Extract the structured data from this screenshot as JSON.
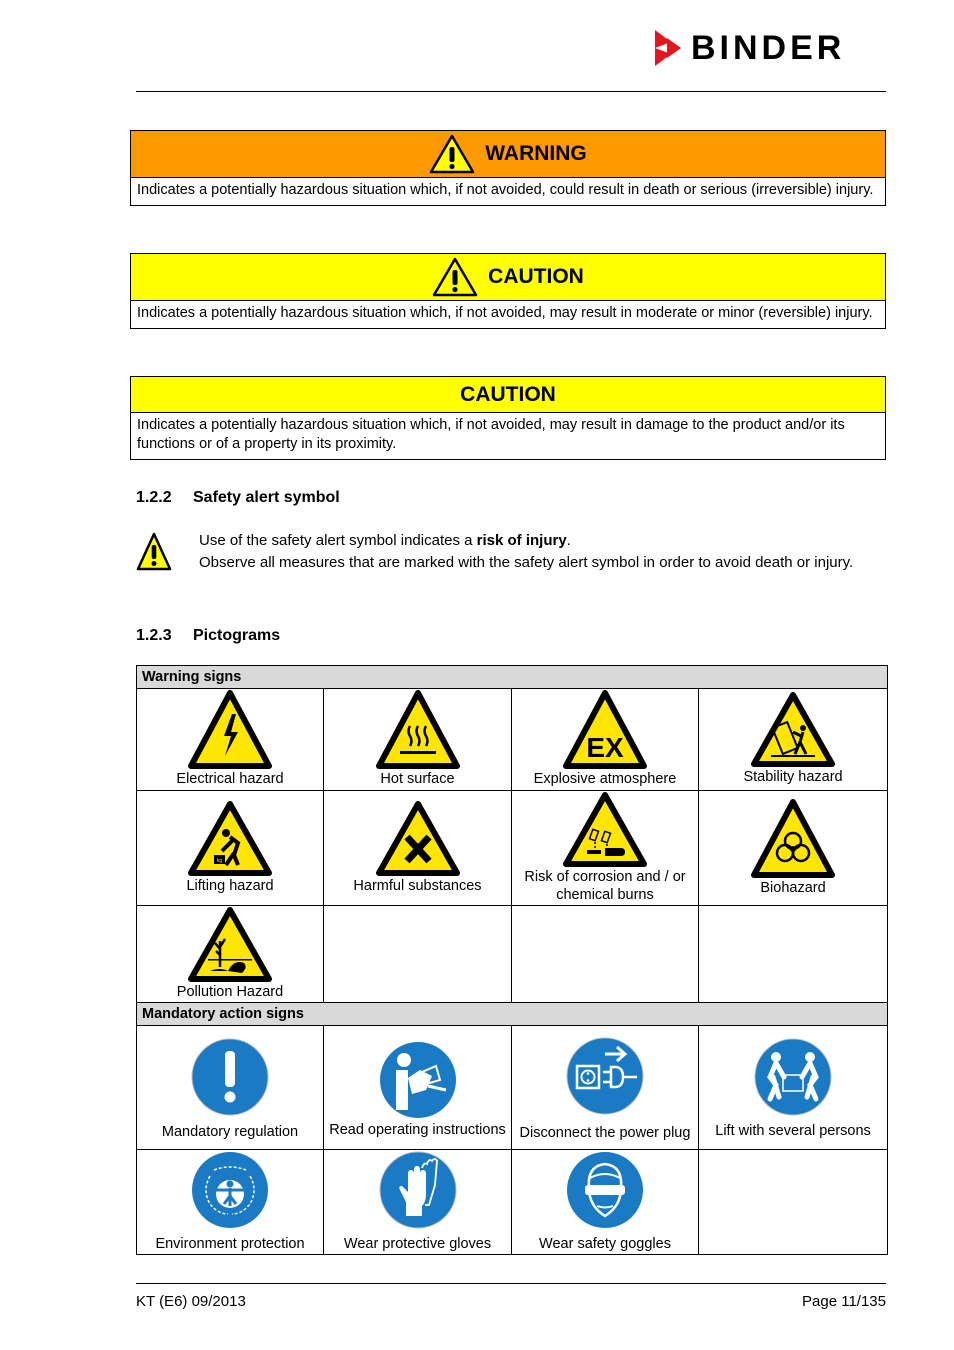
{
  "header": {
    "brand": "BINDER",
    "brand_color": "#e8141b"
  },
  "signal_words": [
    {
      "title": "WARNING",
      "color": "#ff9900",
      "icon": "warning-triangle-icon",
      "text": "Indicates a potentially hazardous situation which, if not avoided, could result in death or serious (irreversible) injury."
    },
    {
      "title": "CAUTION",
      "color": "#ffff00",
      "icon": "warning-triangle-icon",
      "text": "Indicates a potentially hazardous situation which, if not avoided, may result in moderate or minor (reversible) injury."
    },
    {
      "title": "CAUTION",
      "color": "#ffff00",
      "icon": null,
      "text": "Indicates a potentially hazardous situation which, if not avoided, may result in damage to the product and/or its functions or of a property in its proximity."
    }
  ],
  "section_safety_alert": {
    "number": "1.2.2",
    "title": "Safety alert symbol",
    "line1_prefix": "Use of the safety alert symbol indicates a ",
    "line1_bold": "risk of injury",
    "line1_suffix": ".",
    "line2": "Observe all measures that are marked with the safety alert symbol in order to avoid death or injury."
  },
  "section_pictograms": {
    "number": "1.2.3",
    "title": "Pictograms",
    "warning_header": "Warning signs",
    "warning_signs": [
      {
        "label": "Electrical hazard",
        "icon": "electrical-hazard-icon"
      },
      {
        "label": "Hot surface",
        "icon": "hot-surface-icon"
      },
      {
        "label": "Explosive atmosphere",
        "icon": "explosive-atmosphere-icon"
      },
      {
        "label": "Stability hazard",
        "icon": "stability-hazard-icon"
      },
      {
        "label": "Lifting hazard",
        "icon": "lifting-hazard-icon"
      },
      {
        "label": "Harmful substances",
        "icon": "harmful-substances-icon"
      },
      {
        "label": "Risk of corrosion and / or chemical burns",
        "icon": "corrosion-icon"
      },
      {
        "label": "Biohazard",
        "icon": "biohazard-icon"
      },
      {
        "label": "Pollution Hazard",
        "icon": "pollution-hazard-icon"
      }
    ],
    "mandatory_header": "Mandatory action signs",
    "mandatory_signs": [
      {
        "label": "Mandatory regulation",
        "icon": "mandatory-exclamation-icon"
      },
      {
        "label": "Read operating instructions",
        "icon": "read-instructions-icon"
      },
      {
        "label": "Disconnect the power plug",
        "icon": "disconnect-plug-icon"
      },
      {
        "label": "Lift with several persons",
        "icon": "lift-several-persons-icon"
      },
      {
        "label": "Environment protection",
        "icon": "environment-protection-icon"
      },
      {
        "label": "Wear protective gloves",
        "icon": "protective-gloves-icon"
      },
      {
        "label": "Wear safety goggles",
        "icon": "safety-goggles-icon"
      }
    ],
    "warning_color": "#ffe600",
    "mandatory_color": "#1a7ac4"
  },
  "footer": {
    "doc_code": "KT (E6) 09/2013",
    "page": "Page 11/135"
  }
}
